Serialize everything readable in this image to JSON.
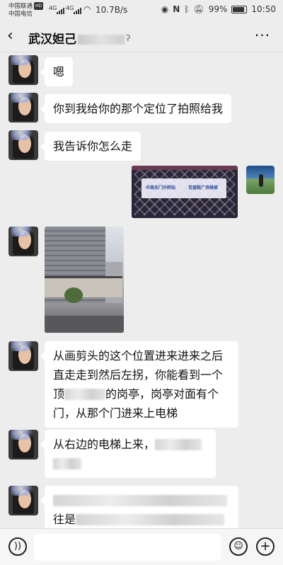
{
  "status_bar": {
    "carrier_1": "中国联通",
    "carrier_1_badge": "HD",
    "carrier_2": "中国电信",
    "signal_1": "4G",
    "signal_2": "4G",
    "net_speed": "10.7B/s",
    "battery": "99%",
    "time": "10:50",
    "icons": [
      "eye-icon",
      "nfc-icon",
      "bluetooth-icon",
      "mute-icon",
      "wifi-icon",
      "battery-icon"
    ]
  },
  "header": {
    "title": "武汉妲己",
    "back_icon": "‹",
    "more_icon": "···"
  },
  "messages": [
    {
      "from": "other",
      "type": "text",
      "text": "嗯"
    },
    {
      "from": "other",
      "type": "text",
      "text": "你到我给你的那个定位了拍照给我"
    },
    {
      "from": "other",
      "type": "text",
      "text": "我告诉你怎么走"
    },
    {
      "from": "me",
      "type": "image"
    },
    {
      "from": "other",
      "type": "image"
    },
    {
      "from": "other",
      "type": "text",
      "lines": [
        "从画剪头的这个位置进来进来之后",
        "直走走到然后左拐，你能看到一个",
        "的岗亭，岗亭对面有个",
        "门，从那个门进来上电梯"
      ],
      "line3_prefix": "顶"
    },
    {
      "from": "other",
      "type": "text",
      "lines": [
        "从右边的电梯上来，"
      ]
    },
    {
      "from": "other",
      "type": "text",
      "lines": [
        "往是"
      ]
    }
  ],
  "photo_sign": {
    "left": "中商东门中转站",
    "right": "百盛鞋广场维修"
  },
  "input_bar": {
    "voice_icon": "voice-icon",
    "emoji_icon": "emoji-icon",
    "plus_icon": "plus-icon"
  }
}
